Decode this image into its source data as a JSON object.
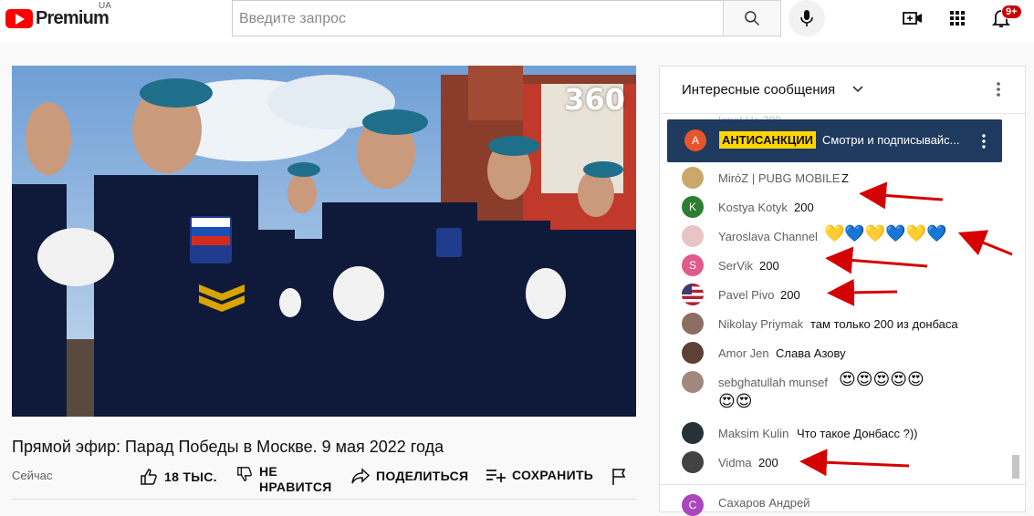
{
  "header": {
    "logo_text": "Premium",
    "country": "UA",
    "search_placeholder": "Введите запрос",
    "notifications_badge": "9+"
  },
  "video": {
    "watermark": "360",
    "title": "Прямой эфир: Парад Победы в Москве. 9 мая 2022 года",
    "date": "Сейчас",
    "likes": "18 ТЫС.",
    "dislike_line1": "НЕ",
    "dislike_line2": "НРАВИТСЯ",
    "share": "ПОДЕЛИТЬСЯ",
    "save": "СОХРАНИТЬ"
  },
  "chat": {
    "title": "Интересные сообщения",
    "ghost_text": "Ignat Ha   200",
    "pinned": {
      "initial": "A",
      "author": "АНТИСАНКЦИИ",
      "text": "Смотри и подписывайс..."
    },
    "messages": [
      {
        "author": "MiróZ | PUBG MOBILE",
        "text": "Z",
        "avatar": "",
        "color": "#c9a86a"
      },
      {
        "author": "Kostya Kotyk",
        "text": "200",
        "avatar": "K",
        "color": "#2e7d32"
      },
      {
        "author": "Yaroslava Channel",
        "text": "💛💙💛💙💛💙",
        "avatar": "",
        "color": "#e8c4c4"
      },
      {
        "author": "SerVik",
        "text": "200",
        "avatar": "S",
        "color": "#e05a8a"
      },
      {
        "author": "Pavel Pivo",
        "text": "200",
        "avatar": "",
        "color": "#3b5998"
      },
      {
        "author": "Nikolay Priymak",
        "text": "там только 200 из донбаса",
        "avatar": "",
        "color": "#8d6e63"
      },
      {
        "author": "Amor Jen",
        "text": "Слава Азову",
        "avatar": "",
        "color": "#5d4037"
      },
      {
        "author": "sebghatullah munsef",
        "text": "😍😍😍😍😍",
        "text2": "😍😍",
        "avatar": "",
        "color": "#a1887f"
      },
      {
        "author": "Maksim Kulin",
        "text": "Что такое Донбасс ?))",
        "avatar": "",
        "color": "#263238"
      },
      {
        "author": "Vidma",
        "text": "200",
        "avatar": "",
        "color": "#424242"
      },
      {
        "author": "Сахаров Андрей",
        "text": "",
        "avatar": "C",
        "color": "#ab47bc"
      }
    ]
  },
  "colors": {
    "brand_red": "#ff0000",
    "pinned_bg": "#1e3a5f",
    "pinned_author_bg": "#ffd600",
    "annotation_arrow": "#d50000"
  }
}
